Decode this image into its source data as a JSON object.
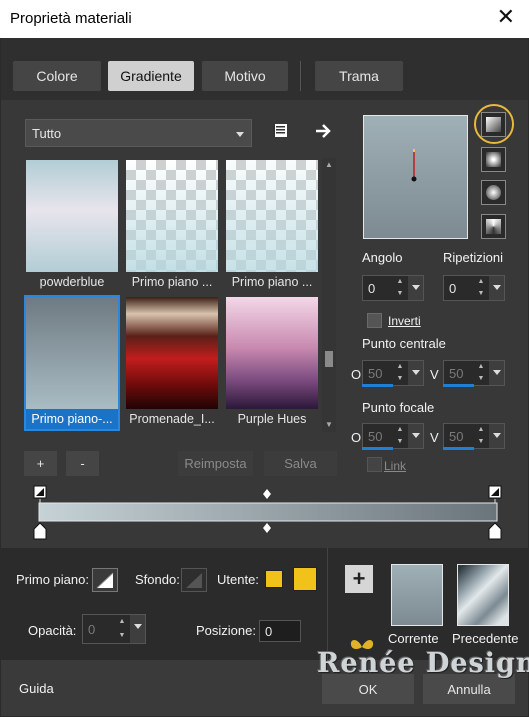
{
  "window": {
    "title": "Proprietà materiali",
    "close": "✕"
  },
  "tabs": [
    {
      "label": "Colore",
      "selected": false
    },
    {
      "label": "Gradiente",
      "selected": true
    },
    {
      "label": "Motivo",
      "selected": false
    },
    {
      "label": "Trama",
      "selected": false
    }
  ],
  "library": {
    "category": "Tutto",
    "items": [
      {
        "label": "powderblue"
      },
      {
        "label": "Primo piano ..."
      },
      {
        "label": "Primo piano ..."
      },
      {
        "label": "Primo piano-...",
        "selected": true
      },
      {
        "label": "Promenade_I..."
      },
      {
        "label": "Purple Hues"
      }
    ]
  },
  "buttons": {
    "add": "+",
    "remove": "-",
    "reset": "Reimposta",
    "save": "Salva",
    "ok": "OK",
    "cancel": "Annulla",
    "help": "Guida"
  },
  "style": {
    "angle_label": "Angolo",
    "angle_value": "0",
    "repeat_label": "Ripetizioni",
    "repeat_value": "0",
    "invert_label": "Inverti",
    "center_label": "Punto centrale",
    "center_o_label": "O",
    "center_o": "50",
    "center_v_label": "V",
    "center_v": "50",
    "focal_label": "Punto focale",
    "focal_o_label": "O",
    "focal_o": "50",
    "focal_v_label": "V",
    "focal_v": "50",
    "link_label": "Link"
  },
  "stops": {
    "fg_label": "Primo piano:",
    "bg_label": "Sfondo:",
    "user_label": "Utente:",
    "user_color": "#f0c21a",
    "opacity_label": "Opacità:",
    "opacity_value": "0",
    "position_label": "Posizione:",
    "position_value": "0"
  },
  "preview": {
    "current_label": "Corrente",
    "previous_label": "Precedente"
  },
  "watermark": "Renée Design",
  "colors": {
    "accent": "#1e7fd6",
    "highlight": "#e8b93a",
    "grad_start": "#c8d6da",
    "grad_end": "#66707a"
  }
}
